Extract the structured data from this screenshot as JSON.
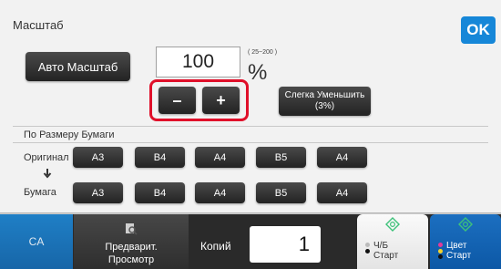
{
  "panel": {
    "title": "Масштаб",
    "ok_label": "OK",
    "auto_scale_label": "Авто Масштаб",
    "zoom_value": "100",
    "zoom_range": "( 25~200 )",
    "zoom_unit": "%",
    "minus_label": "–",
    "plus_label": "+",
    "slight_reduce_line1": "Слегка Уменьшить",
    "slight_reduce_line2": "(3%)"
  },
  "paper": {
    "section_label": "По Размеру Бумаги",
    "original_label": "Оригинал",
    "paper_label": "Бумага",
    "original_sizes": [
      "A3",
      "B4",
      "A4",
      "B5",
      "A4"
    ],
    "paper_sizes": [
      "A3",
      "B4",
      "A4",
      "B5",
      "A4"
    ]
  },
  "bottom": {
    "ca_label": "CA",
    "preview_line1": "Предварит.",
    "preview_line2": "Просмотр",
    "copies_label": "Копий",
    "copies_value": "1",
    "bw_line1": "Ч/Б",
    "bw_line2": "Старт",
    "color_line1": "Цвет",
    "color_line2": "Старт"
  },
  "colors": {
    "accent_blue": "#1687d8",
    "highlight_red": "#e0102a",
    "start_green": "#3ec27a"
  },
  "icons": [
    "preview-icon",
    "bw-start-icon",
    "color-start-icon",
    "arrow-down-icon"
  ]
}
